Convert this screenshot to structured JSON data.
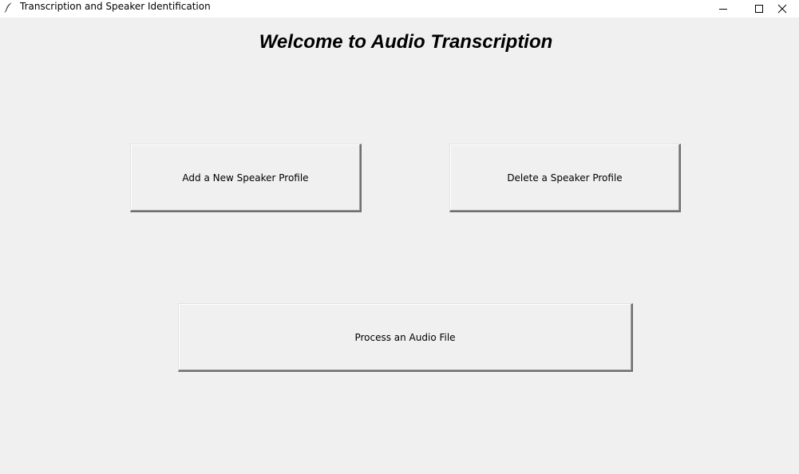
{
  "window": {
    "title": "Transcription and Speaker Identification",
    "icon": "feather-icon",
    "controls": [
      "minimize-icon",
      "maximize-icon",
      "close-icon"
    ]
  },
  "main": {
    "heading": "Welcome to Audio Transcription",
    "buttons": {
      "add_profile": "Add a New Speaker Profile",
      "delete_profile": "Delete a Speaker Profile",
      "process_audio": "Process an Audio File"
    }
  },
  "colors": {
    "background": "#f0f0f0",
    "titlebar": "#ffffff"
  }
}
